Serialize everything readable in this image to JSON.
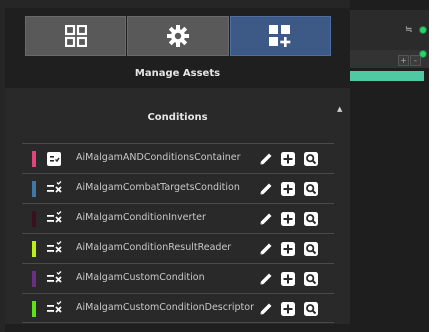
{
  "panel": {
    "title": "Manage Assets",
    "tabs": [
      {
        "name": "grid",
        "icon": "grid-icon",
        "active": false
      },
      {
        "name": "settings",
        "icon": "gear-icon",
        "active": false
      },
      {
        "name": "add-asset",
        "icon": "add-grid-icon",
        "active": true
      }
    ]
  },
  "section": {
    "title": "Conditions",
    "items": [
      {
        "label": "AiMalgamANDConditionsContainer",
        "color": "#e0447f",
        "icon": "checklist-icon"
      },
      {
        "label": "AiMalgamCombatTargetsCondition",
        "color": "#3f78a6",
        "icon": "list-x-icon"
      },
      {
        "label": "AiMalgamConditionInverter",
        "color": "#3a0f1e",
        "icon": "list-x-icon"
      },
      {
        "label": "AiMalgamConditionResultReader",
        "color": "#b9ee18",
        "icon": "list-x-icon"
      },
      {
        "label": "AiMalgamCustomCondition",
        "color": "#6a2f7e",
        "icon": "list-x-icon"
      },
      {
        "label": "AiMalgamCustomConditionDescriptor",
        "color": "#5fe01c",
        "icon": "list-x-icon"
      }
    ],
    "actions": [
      "edit-icon",
      "add-icon",
      "inspect-icon"
    ]
  },
  "side": {
    "mini_plus": "+",
    "mini_minus": "-",
    "glyph": "≒"
  }
}
